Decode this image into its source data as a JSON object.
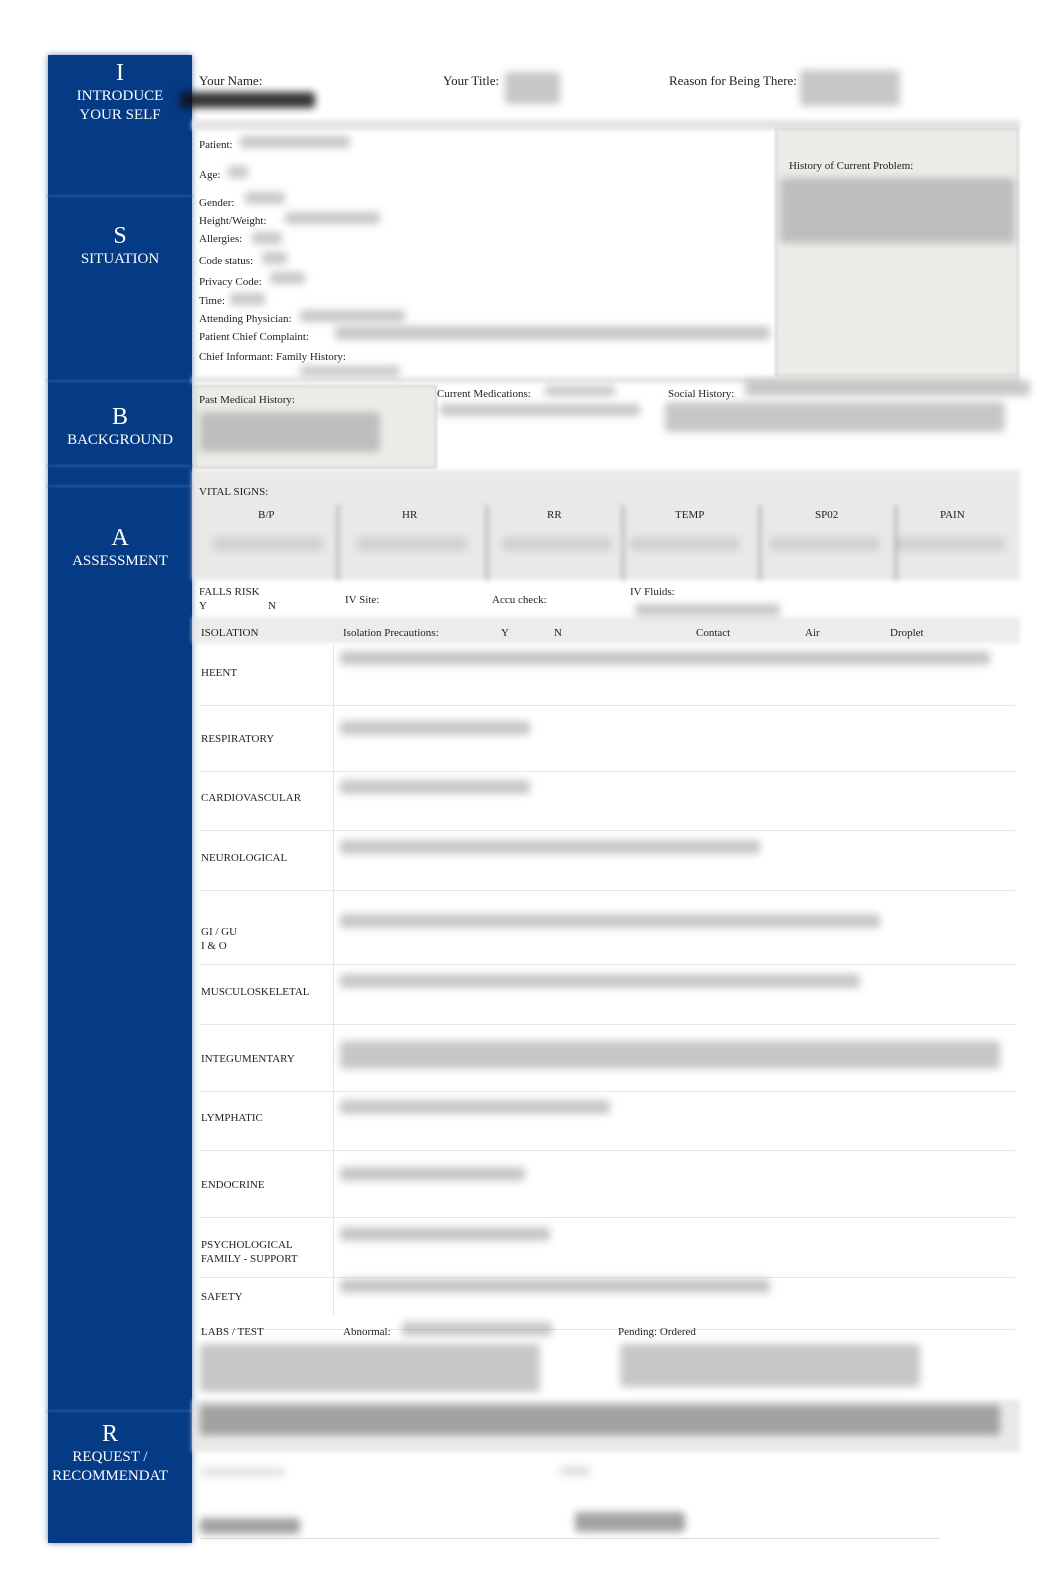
{
  "sidebar": {
    "color": "#053a85",
    "sections": [
      {
        "letter": "I",
        "title_line1": "INTRODUCE",
        "title_line2": "YOUR SELF"
      },
      {
        "letter": "S",
        "title_line1": "SITUATION",
        "title_line2": ""
      },
      {
        "letter": "B",
        "title_line1": "BACKGROUND",
        "title_line2": ""
      },
      {
        "letter": "A",
        "title_line1": "ASSESSMENT",
        "title_line2": ""
      },
      {
        "letter": "R",
        "title_line1": "REQUEST /",
        "title_line2": "RECOMMENDAT"
      }
    ]
  },
  "header": {
    "your_name": "Your Name:",
    "your_title": "Your Title:",
    "reason": "Reason for Being There:"
  },
  "situation": {
    "patient": "Patient:",
    "age": "Age:",
    "gender": "Gender:",
    "height_weight": "Height/Weight:",
    "allergies": "Allergies:",
    "code_status": "Code status:",
    "privacy_code": "Privacy Code:",
    "time": "Time:",
    "attending": "Attending Physician:",
    "chief_complaint": "Patient Chief Complaint:",
    "chief_informant": "Chief Informant:",
    "family_history": "Family History:",
    "history_current": "History of Current Problem:"
  },
  "background": {
    "past_medical": "Past Medical History:",
    "current_meds": "Current Medications:",
    "social_history": "Social History:"
  },
  "vitals": {
    "title": "VITAL SIGNS:",
    "columns": [
      "B/P",
      "HR",
      "RR",
      "TEMP",
      "SP02",
      "PAIN"
    ]
  },
  "misc": {
    "falls_risk": "FALLS RISK",
    "yes": "Y",
    "no": "N",
    "iv_site": "IV Site:",
    "accu_check": "Accu check:",
    "iv_fluids": "IV Fluids:",
    "isolation": "ISOLATION",
    "isolation_precautions": "Isolation Precautions:",
    "contact": "Contact",
    "air": "Air",
    "droplet": "Droplet"
  },
  "systems": [
    [
      "HEENT"
    ],
    [
      "RESPIRATORY"
    ],
    [
      "CARDIOVASCULAR"
    ],
    [
      "NEUROLOGICAL"
    ],
    [
      "GI / GU",
      "I & O"
    ],
    [
      "MUSCULOSKELETAL"
    ],
    [
      "INTEGUMENTARY"
    ],
    [
      "LYMPHATIC"
    ],
    [
      "ENDOCRINE"
    ],
    [
      "PSYCHOLOGICAL",
      "FAMILY - SUPPORT"
    ],
    [
      "SAFETY"
    ]
  ],
  "labs": {
    "title": "LABS / TEST",
    "abnormal": "Abnormal:",
    "pending": "Pending: Ordered"
  }
}
